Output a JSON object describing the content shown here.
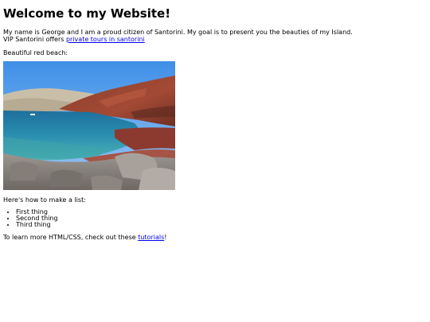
{
  "page": {
    "title": "Welcome to my Website!",
    "intro_line1": "My name is George and I am a proud citizen of Santorini. My goal is to present you the beauties of my Island.",
    "intro_line2_prefix": "VIP Santorini offers ",
    "intro_link": "private tours in santorini",
    "beach_label": "Beautiful red beach:",
    "list_label": "Here's how to make a list:",
    "list_items": [
      "First thing",
      "Second thing",
      "Third thing"
    ],
    "footer_prefix": "To learn more HTML/CSS, check out these ",
    "footer_link": "tutorials",
    "footer_suffix": "!"
  },
  "colors": {
    "link": "#0000ee",
    "text": "#000000",
    "background": "#ffffff"
  }
}
